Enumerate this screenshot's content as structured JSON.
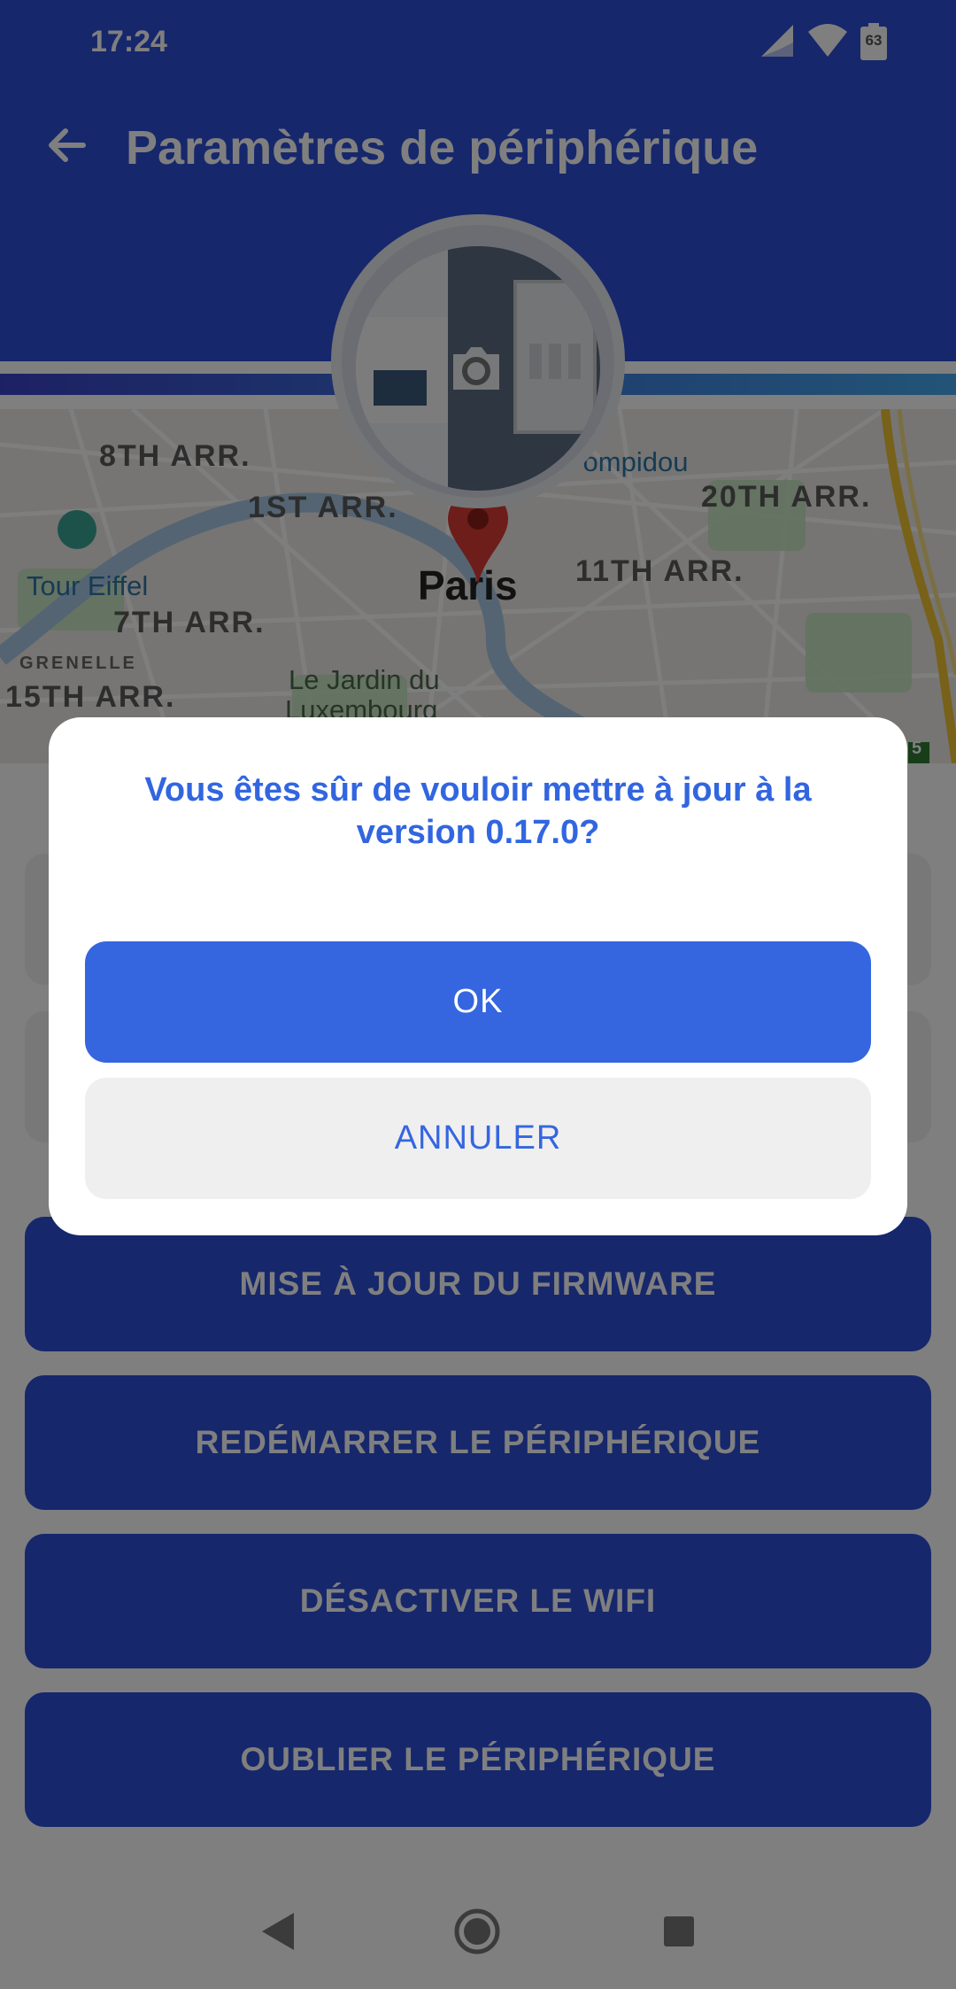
{
  "status_bar": {
    "time": "17:24",
    "battery_level": "63",
    "icons": [
      "signal-icon",
      "wifi-icon",
      "battery-icon"
    ]
  },
  "header": {
    "title": "Paramètres de périphérique",
    "back_icon": "arrow-left-icon"
  },
  "map": {
    "labels": {
      "arr8": "8TH ARR.",
      "arr1": "1ST ARR.",
      "pompidou": "e Pompidou",
      "arr20": "20TH ARR.",
      "eiffel": "Tour Eiffel",
      "paris": "Paris",
      "arr11": "11TH ARR.",
      "arr7": "7TH ARR.",
      "grenelle": "GRENELLE",
      "jardin": "Le Jardin du",
      "luxembourg": "Luxembourg",
      "arr15": "15TH ARR.",
      "road5": "5"
    }
  },
  "actions": {
    "firmware": "MISE À JOUR DU FIRMWARE",
    "restart": "REDÉMARRER LE PÉRIPHÉRIQUE",
    "wifi_off": "DÉSACTIVER LE WIFI",
    "forget": "OUBLIER LE PÉRIPHÉRIQUE"
  },
  "dialog": {
    "message": "Vous êtes sûr de vouloir mettre à jour à la version 0.17.0?",
    "ok_label": "OK",
    "cancel_label": "ANNULER"
  },
  "nav": {
    "icons": [
      "back-triangle-icon",
      "home-circle-icon",
      "recents-square-icon"
    ]
  },
  "colors": {
    "primary": "#2d4ed8",
    "dialog_accent": "#3566e0",
    "scrim": "rgba(0,0,0,0.5)"
  }
}
